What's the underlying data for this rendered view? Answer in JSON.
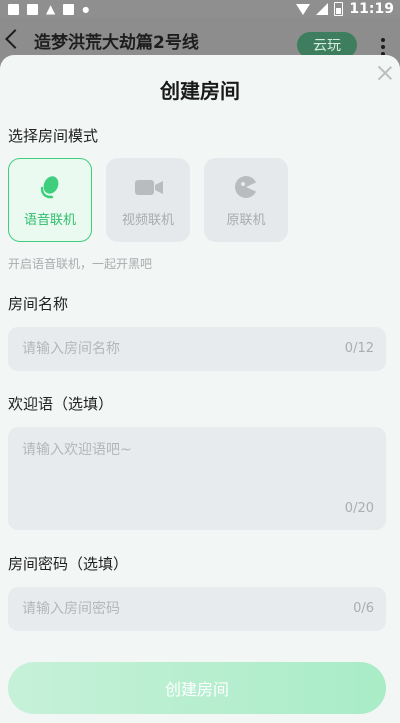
{
  "status_bar": {
    "time": "11:19"
  },
  "header": {
    "title": "造梦洪荒大劫篇2号线",
    "cloud_play_label": "云玩"
  },
  "dialog": {
    "title": "创建房间",
    "mode_section_label": "选择房间模式",
    "modes": [
      {
        "label": "语音联机",
        "icon": "microphone-icon",
        "selected": true
      },
      {
        "label": "视频联机",
        "icon": "video-camera-icon",
        "selected": false
      },
      {
        "label": "原联机",
        "icon": "gamepad-icon",
        "selected": false
      }
    ],
    "mode_hint": "开启语音联机，一起开黑吧",
    "room_name": {
      "label": "房间名称",
      "placeholder": "请输入房间名称",
      "counter": "0/12"
    },
    "welcome": {
      "label": "欢迎语（选填）",
      "placeholder": "请输入欢迎语吧~",
      "counter": "0/20"
    },
    "password": {
      "label": "房间密码（选填）",
      "placeholder": "请输入房间密码",
      "counter": "0/6"
    },
    "create_button": "创建房间"
  },
  "colors": {
    "accent": "#3ecf7e",
    "button_gradient_start": "#c6f1d9",
    "button_gradient_end": "#a9ecc6"
  }
}
